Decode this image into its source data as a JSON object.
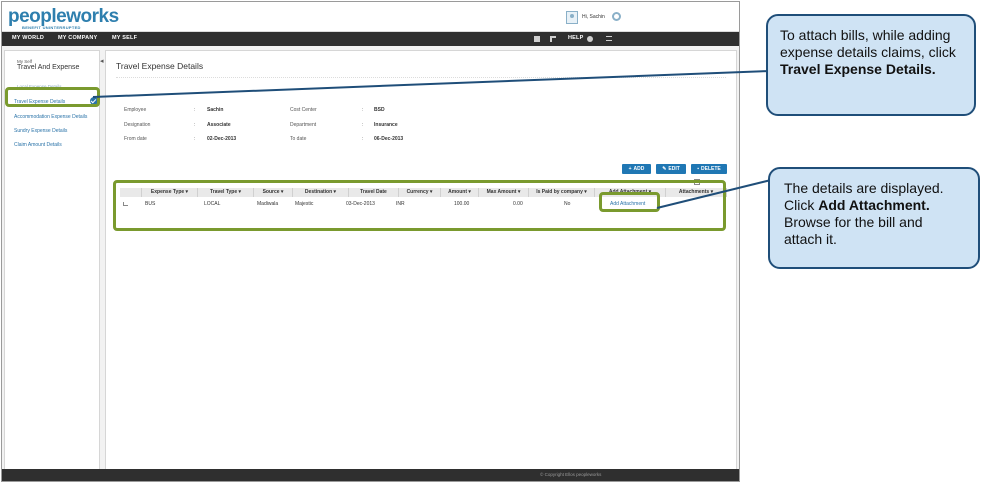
{
  "app": {
    "logo": "peopleworks",
    "logo_tagline": "BENEFIT UNINTERRUPTED",
    "greeting": "Hi, Sachin"
  },
  "nav": {
    "items": [
      "MY WORLD",
      "MY COMPANY",
      "MY SELF"
    ],
    "help": "HELP"
  },
  "sidebar": {
    "breadcrumb": "My Self",
    "title": "Travel And Expense",
    "hidden_item": "Local Expense Details",
    "items": [
      "Travel Expense Details",
      "Accommodation Expense Details",
      "Sundry Expense Details",
      "Claim Amount Details"
    ]
  },
  "main": {
    "title": "Travel Expense Details",
    "fields": {
      "employee_label": "Employee",
      "employee_value": "Sachin",
      "cost_center_label": "Cost Center",
      "cost_center_value": "BSD",
      "designation_label": "Designation",
      "designation_value": "Associate",
      "department_label": "Department",
      "department_value": "Insurance",
      "from_date_label": "From date",
      "from_date_value": "02-Dec-2013",
      "to_date_label": "To date",
      "to_date_value": "06-Dec-2013",
      "colon": ":"
    },
    "buttons": {
      "add": "ADD",
      "edit": "EDIT",
      "delete": "DELETE"
    },
    "table": {
      "headers": [
        "Expense Type",
        "Travel Type",
        "Source",
        "Destination",
        "Travel Date",
        "Currency",
        "Amount",
        "Max Amount",
        "Is Paid by company",
        "Add Attachment",
        "Attachments"
      ],
      "rows": [
        [
          "BUS",
          "LOCAL",
          "Madiwala",
          "Majestic",
          "03-Dec-2013",
          "INR",
          "100.00",
          "0.00",
          "No",
          "Add Attachment",
          ""
        ]
      ]
    }
  },
  "footer": {
    "text": "© Copyright Ellos peopleworks"
  },
  "callouts": {
    "first_pre": "To attach bills, while adding expense details claims, click ",
    "first_bold": "Travel Expense Details.",
    "second_pre": "The details are displayed. Click ",
    "second_bold": "Add Attachment.",
    "second_post": " Browse for the bill and attach it."
  },
  "colors": {
    "highlight": "#7a9a2e",
    "callout_fill": "#cfe3f4",
    "callout_border": "#1f4e79",
    "accent": "#1f77b4"
  }
}
